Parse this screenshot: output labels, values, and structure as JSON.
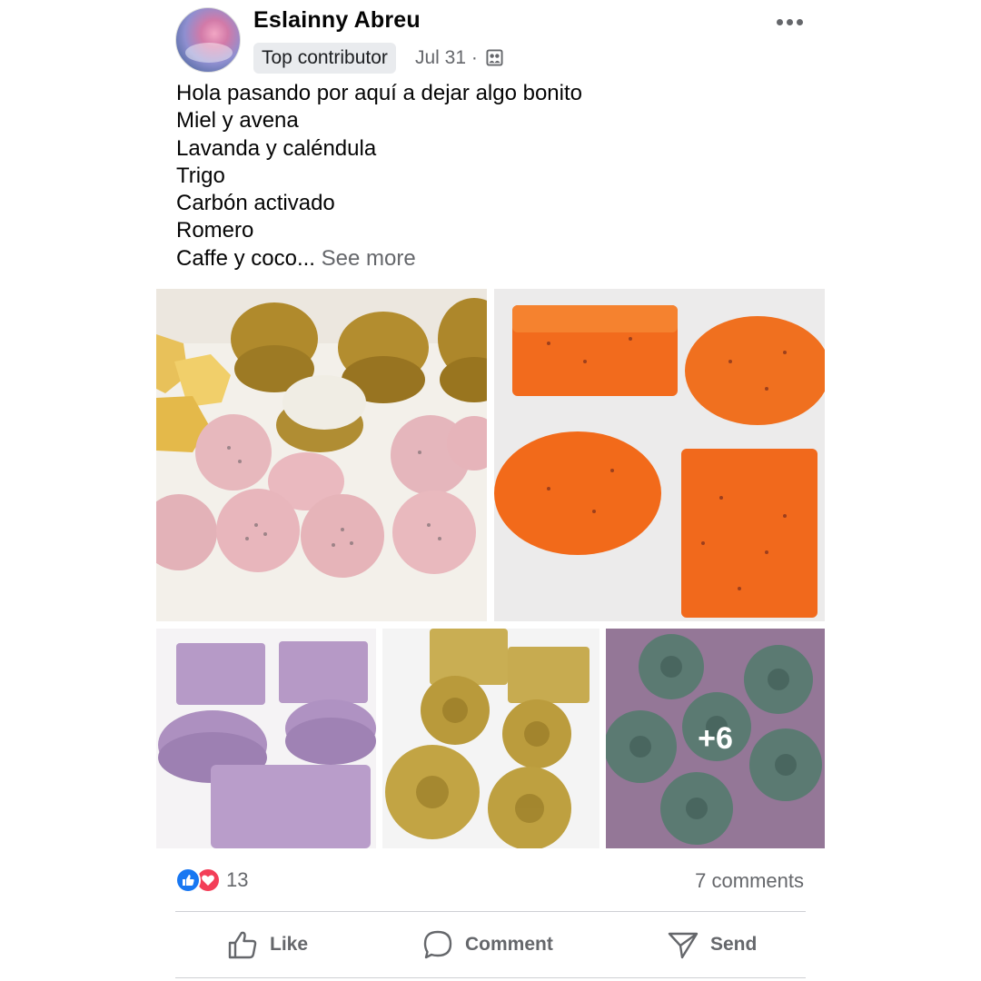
{
  "post": {
    "author": "Eslainny Abreu",
    "badge": "Top contributor",
    "date": "Jul 31 ·",
    "lines": [
      "Hola pasando por aquí a dejar algo bonito",
      "Miel y avena",
      "Lavanda y caléndula",
      "Trigo",
      "Carbón activado",
      "Romero"
    ],
    "last_line": "Caffe y coco...",
    "see_more": "See more"
  },
  "photos": {
    "overlay_count": "+6"
  },
  "engagement": {
    "reaction_count": "13",
    "comments": "7 comments"
  },
  "actions": {
    "like": "Like",
    "comment": "Comment",
    "send": "Send"
  },
  "colors": {
    "like_blue": "#1877f2",
    "love_red": "#f33e58",
    "secondary_text": "#65676b"
  }
}
